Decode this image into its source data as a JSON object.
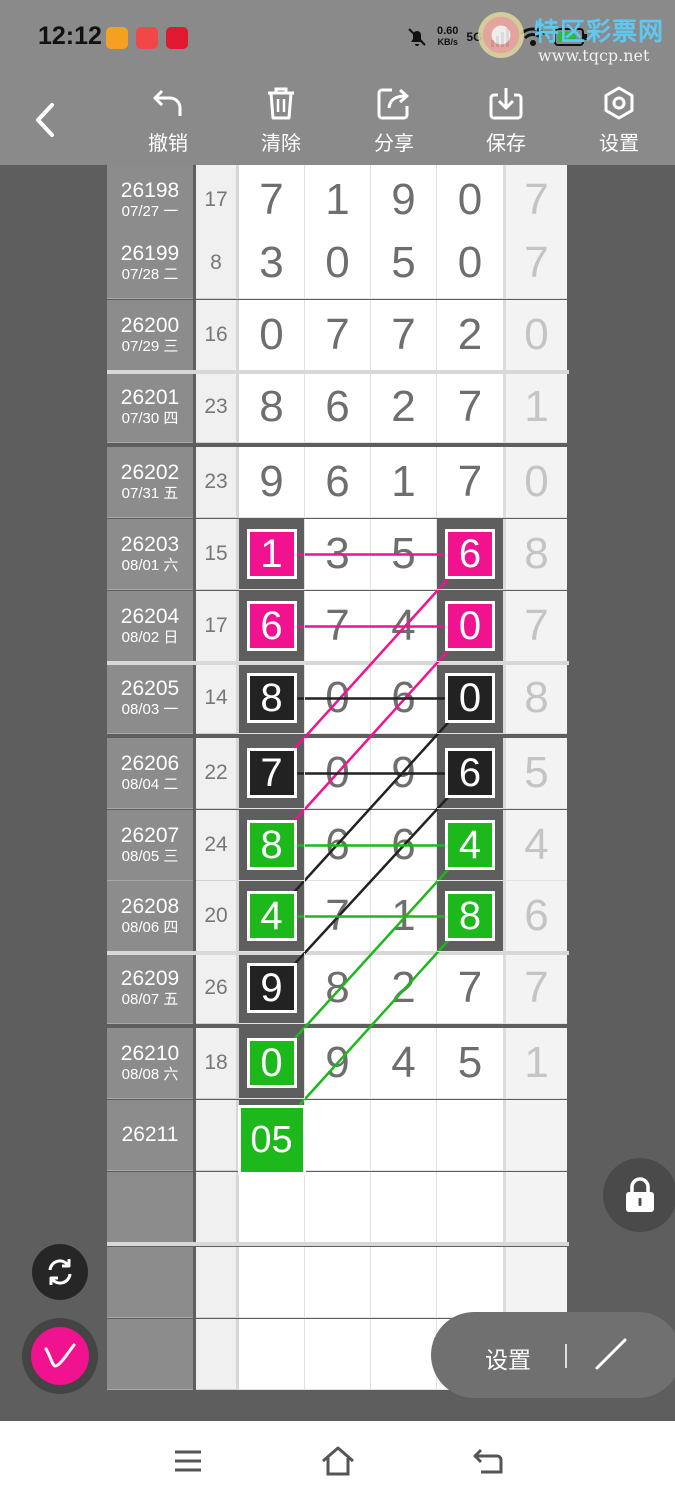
{
  "status": {
    "time": "12:12",
    "speed_value": "0.60",
    "speed_unit": "KB/s",
    "network": "5G"
  },
  "watermark": {
    "title": "特区彩票网",
    "url": "www.tqcp.net"
  },
  "toolbar": {
    "undo_label": "撤销",
    "clear_label": "清除",
    "share_label": "分享",
    "save_label": "保存",
    "settings_label": "设置"
  },
  "table": {
    "rows": [
      {
        "period": "26198",
        "date": "07/27 一",
        "sum": "17",
        "digits": [
          "7",
          "1",
          "9",
          "0"
        ],
        "extra": "7"
      },
      {
        "period": "26199",
        "date": "07/28 二",
        "sum": "8",
        "digits": [
          "3",
          "0",
          "5",
          "0"
        ],
        "extra": "7"
      },
      {
        "period": "26200",
        "date": "07/29 三",
        "sum": "16",
        "digits": [
          "0",
          "7",
          "7",
          "2"
        ],
        "extra": "0"
      },
      {
        "period": "26201",
        "date": "07/30 四",
        "sum": "23",
        "digits": [
          "8",
          "6",
          "2",
          "7"
        ],
        "extra": "1"
      },
      {
        "period": "26202",
        "date": "07/31 五",
        "sum": "23",
        "digits": [
          "9",
          "6",
          "1",
          "7"
        ],
        "extra": "0"
      },
      {
        "period": "26203",
        "date": "08/01 六",
        "sum": "15",
        "digits": [
          "1",
          "3",
          "5",
          "6"
        ],
        "extra": "8"
      },
      {
        "period": "26204",
        "date": "08/02 日",
        "sum": "17",
        "digits": [
          "6",
          "7",
          "4",
          "0"
        ],
        "extra": "7"
      },
      {
        "period": "26205",
        "date": "08/03 一",
        "sum": "14",
        "digits": [
          "8",
          "0",
          "6",
          "0"
        ],
        "extra": "8"
      },
      {
        "period": "26206",
        "date": "08/04 二",
        "sum": "22",
        "digits": [
          "7",
          "0",
          "9",
          "6"
        ],
        "extra": "5"
      },
      {
        "period": "26207",
        "date": "08/05 三",
        "sum": "24",
        "digits": [
          "8",
          "6",
          "6",
          "4"
        ],
        "extra": "4"
      },
      {
        "period": "26208",
        "date": "08/06 四",
        "sum": "20",
        "digits": [
          "4",
          "7",
          "1",
          "8"
        ],
        "extra": "6"
      },
      {
        "period": "26209",
        "date": "08/07 五",
        "sum": "26",
        "digits": [
          "9",
          "8",
          "2",
          "7"
        ],
        "extra": "7"
      },
      {
        "period": "26210",
        "date": "08/08 六",
        "sum": "18",
        "digits": [
          "0",
          "9",
          "4",
          "5"
        ],
        "extra": "1"
      },
      {
        "period": "26211",
        "date": "",
        "sum": "",
        "digits": [
          "05",
          "",
          "",
          ""
        ],
        "extra": ""
      }
    ],
    "highlights": [
      {
        "row": 5,
        "col": 0,
        "color": "#f0128e"
      },
      {
        "row": 5,
        "col": 3,
        "color": "#f0128e"
      },
      {
        "row": 6,
        "col": 0,
        "color": "#f0128e"
      },
      {
        "row": 6,
        "col": 3,
        "color": "#f0128e"
      },
      {
        "row": 7,
        "col": 0,
        "color": "#222222"
      },
      {
        "row": 7,
        "col": 3,
        "color": "#222222"
      },
      {
        "row": 8,
        "col": 0,
        "color": "#222222"
      },
      {
        "row": 8,
        "col": 3,
        "color": "#222222"
      },
      {
        "row": 9,
        "col": 0,
        "color": "#1cb81c"
      },
      {
        "row": 9,
        "col": 3,
        "color": "#1cb81c"
      },
      {
        "row": 10,
        "col": 0,
        "color": "#1cb81c"
      },
      {
        "row": 10,
        "col": 3,
        "color": "#1cb81c"
      },
      {
        "row": 11,
        "col": 0,
        "color": "#222222"
      },
      {
        "row": 12,
        "col": 0,
        "color": "#1cb81c"
      },
      {
        "row": 13,
        "col": 0,
        "color": "#1cb81c"
      }
    ],
    "lines": [
      {
        "from": [
          5,
          0
        ],
        "to": [
          5,
          3
        ],
        "color": "#f0128e"
      },
      {
        "from": [
          6,
          0
        ],
        "to": [
          6,
          3
        ],
        "color": "#f0128e"
      },
      {
        "from": [
          5,
          3
        ],
        "to": [
          8,
          0
        ],
        "color": "#f0128e"
      },
      {
        "from": [
          6,
          3
        ],
        "to": [
          9,
          0
        ],
        "color": "#f0128e"
      },
      {
        "from": [
          7,
          0
        ],
        "to": [
          7,
          3
        ],
        "color": "#222222"
      },
      {
        "from": [
          8,
          0
        ],
        "to": [
          8,
          3
        ],
        "color": "#222222"
      },
      {
        "from": [
          7,
          3
        ],
        "to": [
          10,
          0
        ],
        "color": "#222222"
      },
      {
        "from": [
          8,
          3
        ],
        "to": [
          11,
          0
        ],
        "color": "#222222"
      },
      {
        "from": [
          9,
          0
        ],
        "to": [
          9,
          3
        ],
        "color": "#1cb81c"
      },
      {
        "from": [
          10,
          0
        ],
        "to": [
          10,
          3
        ],
        "color": "#1cb81c"
      },
      {
        "from": [
          9,
          3
        ],
        "to": [
          12,
          0
        ],
        "color": "#1cb81c"
      },
      {
        "from": [
          10,
          3
        ],
        "to": [
          13,
          0
        ],
        "color": "#1cb81c"
      }
    ]
  },
  "floating": {
    "settings_label": "设置"
  }
}
